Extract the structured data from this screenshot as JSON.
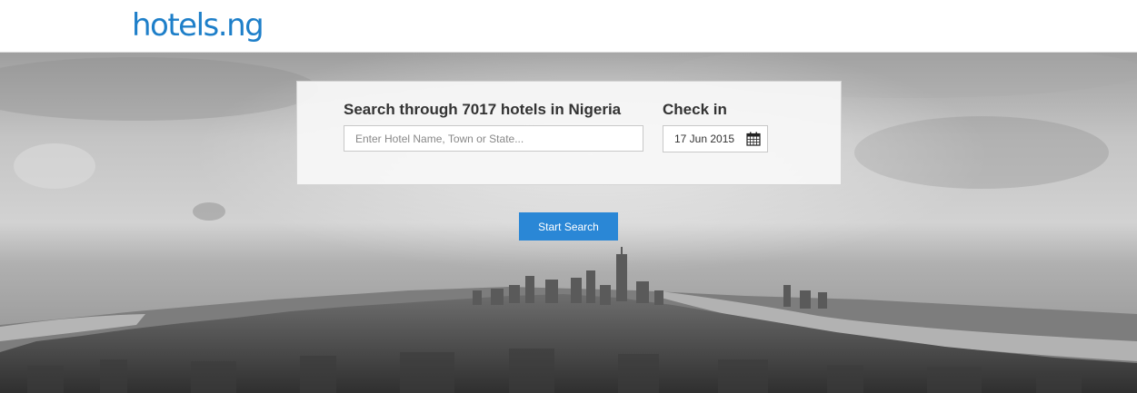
{
  "header": {
    "logo_text": "hotels.ng",
    "brand_color": "#1e7fc9"
  },
  "search": {
    "title": "Search through 7017 hotels in Nigeria",
    "placeholder": "Enter Hotel Name, Town or State...",
    "value": ""
  },
  "checkin": {
    "label": "Check in",
    "date": "17 Jun 2015",
    "icon": "calendar-icon"
  },
  "actions": {
    "start_search_label": "Start Search",
    "button_color": "#2a87d6"
  },
  "background": {
    "description_icon": "city-skyline-image"
  }
}
